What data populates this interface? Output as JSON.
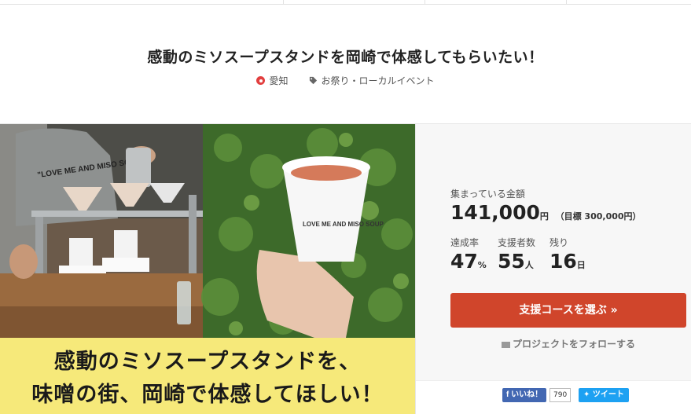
{
  "project": {
    "title": "感動のミソスープスタンドを岡崎で体感してもらいたい！",
    "location": "愛知",
    "category": "お祭り・ローカルイベント"
  },
  "hero": {
    "banner_line1": "感動のミソスープスタンドを、",
    "banner_line2": "味噌の街、岡崎で体感してほしい！",
    "shirt_text": "\"LOVE ME AND MISO SOUP\"",
    "cup_text": "LOVE ME AND MISO SOUP"
  },
  "stats": {
    "funds_label": "集まっている金額",
    "funds_value": "141,000",
    "funds_unit": "円",
    "goal_text": "（目標 300,000円）",
    "rate_label": "達成率",
    "rate_value": "47",
    "rate_unit": "%",
    "supporters_label": "支援者数",
    "supporters_value": "55",
    "supporters_unit": "人",
    "remaining_label": "残り",
    "remaining_value": "16",
    "remaining_unit": "日"
  },
  "actions": {
    "support_button": "支援コースを選ぶ »",
    "follow_link": "プロジェクトをフォローする",
    "like_label": "いいね！",
    "like_count": "790",
    "tweet_label": "ツイート"
  },
  "colors": {
    "accent": "#d0452b",
    "banner": "#f6e97a",
    "facebook": "#4267b2",
    "twitter": "#1da1f2"
  }
}
